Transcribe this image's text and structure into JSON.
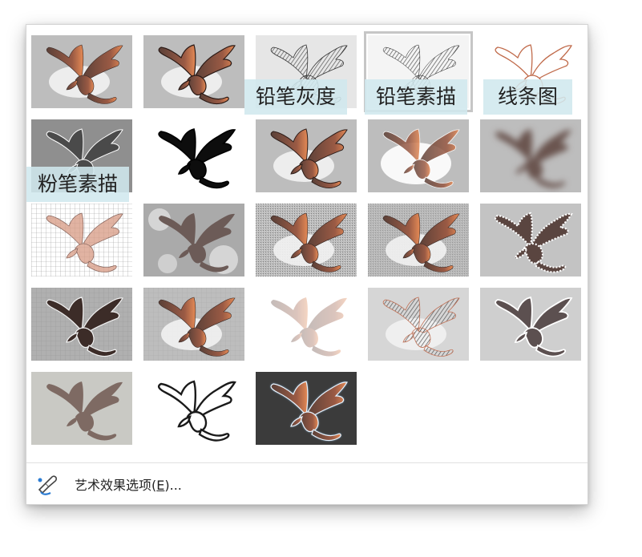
{
  "gallery": {
    "effects": [
      {
        "name": "none",
        "selected": false
      },
      {
        "name": "marker",
        "selected": false
      },
      {
        "name": "pencil-grayscale",
        "selected": false,
        "tooltip": "铅笔灰度"
      },
      {
        "name": "pencil-sketch",
        "selected": true,
        "tooltip": "铅笔素描"
      },
      {
        "name": "line-drawing",
        "selected": false,
        "tooltip": "线条图"
      },
      {
        "name": "chalk-sketch",
        "selected": false,
        "tooltip": "粉笔素描"
      },
      {
        "name": "paint-strokes",
        "selected": false
      },
      {
        "name": "paint-brush",
        "selected": false
      },
      {
        "name": "glow-diffused",
        "selected": false
      },
      {
        "name": "blur",
        "selected": false
      },
      {
        "name": "light-screen",
        "selected": false
      },
      {
        "name": "watercolor-sponge",
        "selected": false
      },
      {
        "name": "film-grain",
        "selected": false
      },
      {
        "name": "mosaic-bubbles",
        "selected": false
      },
      {
        "name": "glass",
        "selected": false
      },
      {
        "name": "cement",
        "selected": false
      },
      {
        "name": "texturizer",
        "selected": false
      },
      {
        "name": "crisscross-etching",
        "selected": false
      },
      {
        "name": "pastels-smooth",
        "selected": false
      },
      {
        "name": "plastic-wrap",
        "selected": false
      },
      {
        "name": "cutout",
        "selected": false
      },
      {
        "name": "photocopy",
        "selected": false
      },
      {
        "name": "glow-edges",
        "selected": false
      }
    ]
  },
  "tooltips": {
    "pencil_grayscale": "铅笔灰度",
    "pencil_sketch": "铅笔素描",
    "line_drawing": "线条图",
    "chalk_sketch": "粉笔素描"
  },
  "footer": {
    "options_prefix": "艺术效果选项(",
    "options_hotkey": "E",
    "options_suffix": ")..."
  },
  "colors": {
    "dragon_body": "#5a4038",
    "dragon_wing_tip": "#e58a55",
    "thumb_bg_gray": "#bdbdbd",
    "tooltip_bg": "#d0e8ee",
    "selected_border": "#c6c6c6",
    "glow_bg": "#3b3b3b"
  }
}
